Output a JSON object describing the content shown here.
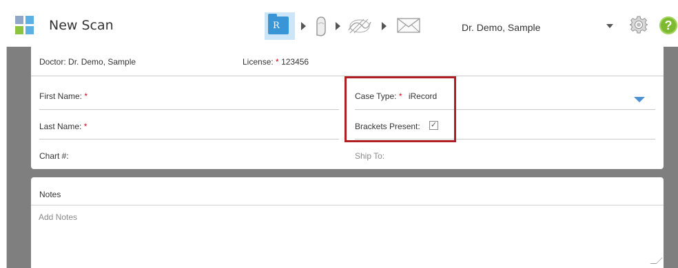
{
  "header": {
    "title": "New Scan",
    "doctor_select": "Dr. Demo, Sample",
    "steps": [
      {
        "name": "rx",
        "letter": "R",
        "active": true
      },
      {
        "name": "scan",
        "active": false
      },
      {
        "name": "view",
        "active": false
      },
      {
        "name": "send",
        "active": false
      }
    ],
    "help_symbol": "?"
  },
  "patient_card": {
    "doctor_label": "Doctor:",
    "doctor_value": "Dr. Demo, Sample",
    "license_label": "License:",
    "license_value": "123456",
    "required_marker": "*",
    "first_name_label": "First Name:",
    "last_name_label": "Last Name:",
    "chart_label": "Chart #:",
    "case_type_label": "Case Type:",
    "case_type_value": "iRecord",
    "brackets_label": "Brackets Present:",
    "brackets_checked": true,
    "check_mark": "✓",
    "ship_to_label": "Ship To:"
  },
  "notes_card": {
    "title": "Notes",
    "placeholder": "Add Notes"
  },
  "colors": {
    "accent_blue": "#3a95d6",
    "required_red": "#d0021b",
    "highlight_red": "#b01e24",
    "help_green": "#7dba2f",
    "backdrop_gray": "#7f7f7f"
  },
  "icons": [
    "app-logo-icon",
    "rx-folder-icon",
    "scan-hand-icon",
    "view-icon",
    "send-mail-icon",
    "chevron-down-icon",
    "gear-icon",
    "help-icon"
  ]
}
